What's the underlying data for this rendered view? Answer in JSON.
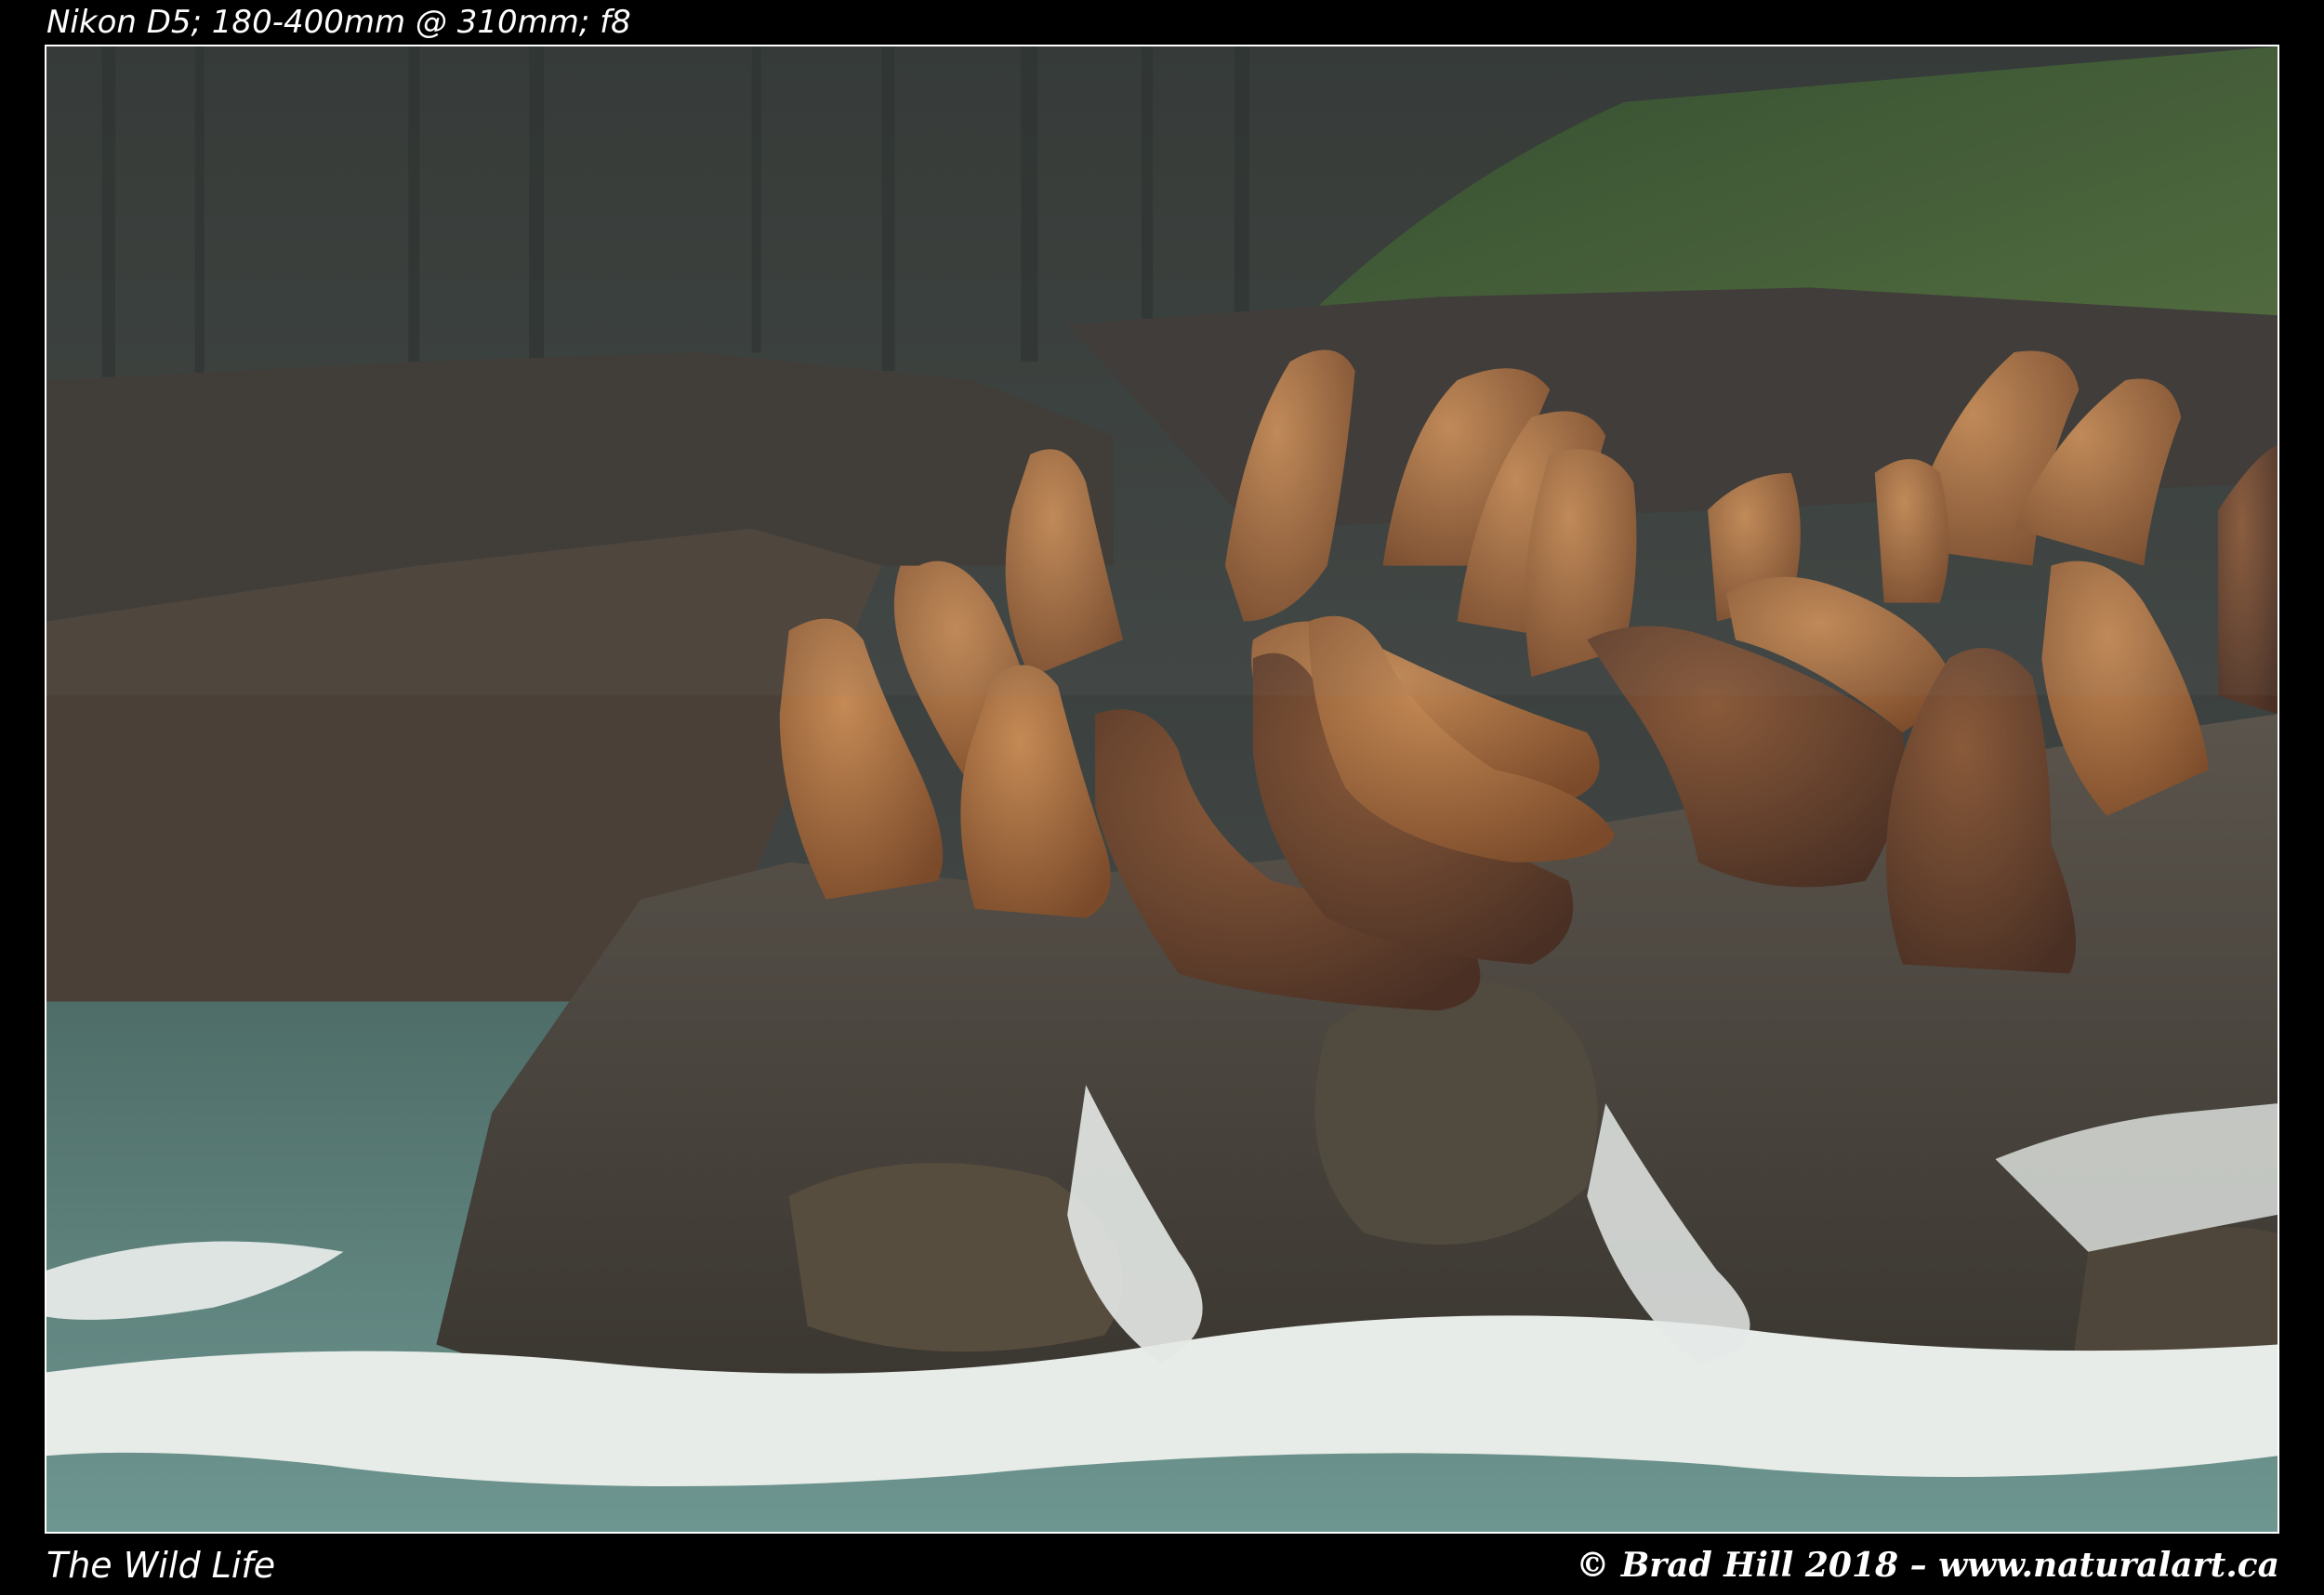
{
  "captions": {
    "camera_info": "Nikon D5; 180-400mm @ 310mm; f8",
    "series_title": "The Wild Life",
    "copyright": "© Brad Hill 2018 – www.naturalart.ca"
  },
  "photo": {
    "subject": "sea-lions-on-rock",
    "colors": {
      "border": "#ffffff",
      "background": "#000000",
      "forest": "#2c3530",
      "fog": "#4a4f4c",
      "rock": "#4a4640",
      "sea_lion": "#a8683a",
      "surf": "#e8ece8",
      "water": "#5f8580"
    }
  }
}
